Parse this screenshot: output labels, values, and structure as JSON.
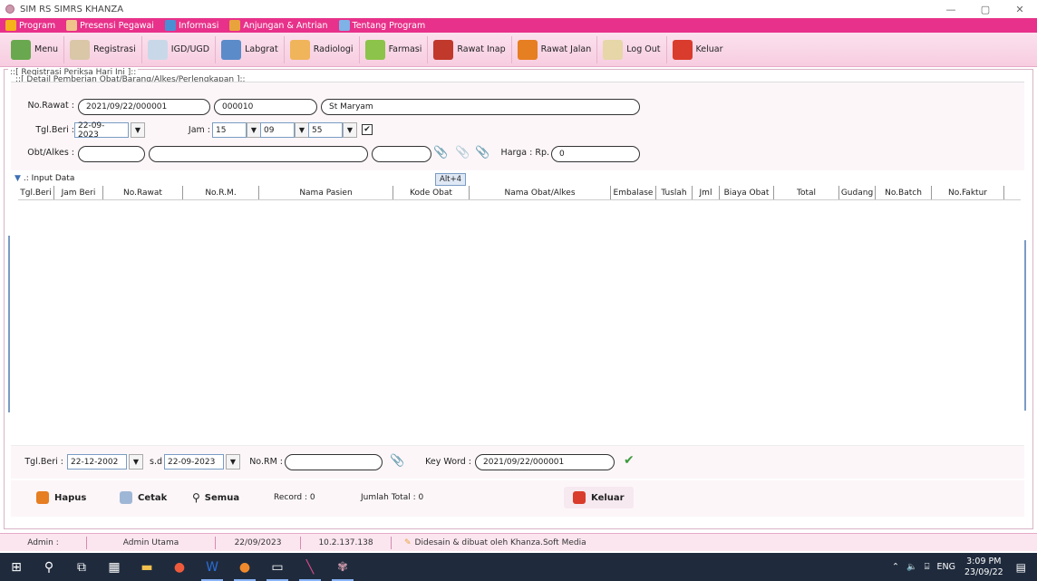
{
  "window": {
    "title": "SIM RS SIMRS KHANZA",
    "min": "—",
    "max": "▢",
    "close": "✕"
  },
  "menu": [
    "Program",
    "Presensi Pegawai",
    "Informasi",
    "Anjungan & Antrian",
    "Tentang Program"
  ],
  "toolbar": [
    "Menu",
    "Registrasi",
    "IGD/UGD",
    "Labgrat",
    "Radiologi",
    "Farmasi",
    "Rawat Inap",
    "Rawat Jalan",
    "Log Out",
    "Keluar"
  ],
  "frame": {
    "title1": "::[ Registrasi Periksa Hari Ini ]::",
    "title2": "::[ Detail Pemberian Obat/Barang/Alkes/Perlengkapan ]::"
  },
  "form": {
    "no_rawat_label": "No.Rawat :",
    "no_rawat": "2021/09/22/000001",
    "no_rm": "000010",
    "nama": "St Maryam",
    "tgl_beri_label": "Tgl.Beri :",
    "tgl_beri": "22-09-2023",
    "jam_label": "Jam :",
    "jam_h": "15",
    "jam_m": "09",
    "jam_s": "55",
    "check": "✔",
    "obat_label": "Obt/Alkes :",
    "harga_label": "Harga : Rp.",
    "harga": "0"
  },
  "input_data_label": ".: Input Data",
  "tooltip": "Alt+4",
  "table": {
    "columns": [
      "Tgl.Beri",
      "Jam Beri",
      "No.Rawat",
      "No.R.M.",
      "Nama Pasien",
      "Kode Obat",
      "Nama Obat/Alkes",
      "Embalase",
      "Tuslah",
      "Jml",
      "Biaya Obat",
      "Total",
      "Gudang",
      "No.Batch",
      "No.Faktur"
    ],
    "rows": []
  },
  "filter": {
    "tgl_label": "Tgl.Beri :",
    "tgl_from": "22-12-2002",
    "sd_label": "s.d",
    "tgl_to": "22-09-2023",
    "norm_label": "No.RM :",
    "norm": "",
    "keyword_label": "Key Word :",
    "keyword": "2021/09/22/000001"
  },
  "bottom": {
    "hapus": "Hapus",
    "cetak": "Cetak",
    "semua": "Semua",
    "record": "Record : 0",
    "jumlah": "Jumlah Total : 0",
    "keluar": "Keluar"
  },
  "status": {
    "user_label": "Admin :",
    "user": "Admin Utama",
    "date": "22/09/2023",
    "ip": "10.2.137.138",
    "credit": "Didesain & dibuat oleh Khanza.Soft Media"
  },
  "taskbar": {
    "lang": "ENG",
    "time": "3:09 PM",
    "date": "23/09/22"
  }
}
